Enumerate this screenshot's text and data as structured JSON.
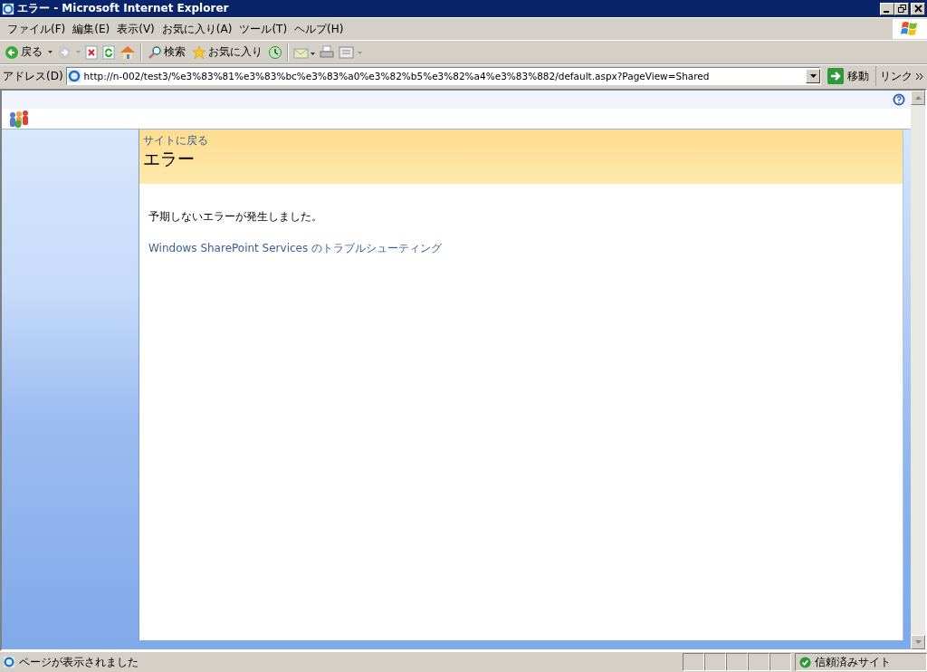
{
  "window": {
    "title": "エラー - Microsoft Internet Explorer"
  },
  "menu": [
    "ファイル(F)",
    "編集(E)",
    "表示(V)",
    "お気に入り(A)",
    "ツール(T)",
    "ヘルプ(H)"
  ],
  "toolbar": {
    "back": "戻る",
    "search": "検索",
    "favorites": "お気に入り"
  },
  "address_bar": {
    "label": "アドレス(D)",
    "url": "http://n-002/test3/%e3%83%81%e3%83%bc%e3%83%a0%e3%82%b5%e3%82%a4%e3%83%882/default.aspx?PageView=Shared",
    "go": "移動",
    "links": "リンク"
  },
  "page": {
    "back_link": "サイトに戻る",
    "title": "エラー",
    "message": "予期しないエラーが発生しました。",
    "help_link": "Windows SharePoint Services のトラブルシューティング"
  },
  "status_bar": {
    "text": "ページが表示されました",
    "zone": "信頼済みサイト"
  }
}
